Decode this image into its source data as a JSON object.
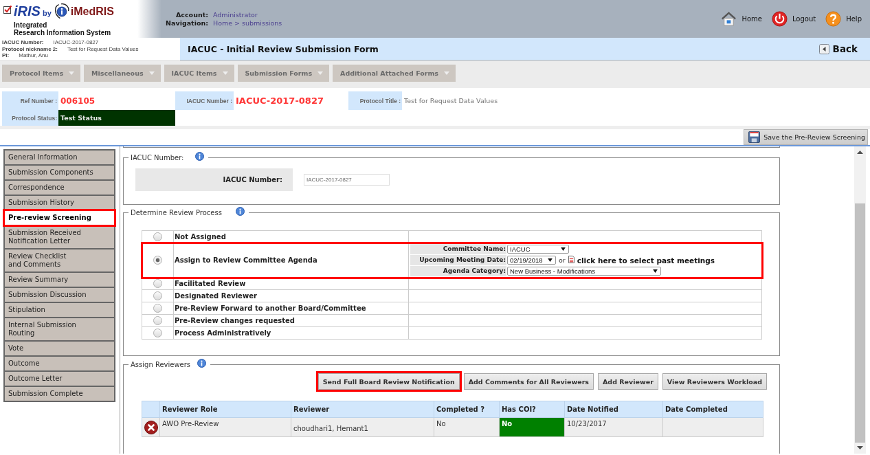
{
  "header": {
    "logo": {
      "brand": "iRIS",
      "by": "by",
      "company": "iMedRIS",
      "tagline": [
        "Integrated",
        "Research Information System"
      ]
    },
    "account": {
      "label": "Account:",
      "value": "Administrator"
    },
    "navigation": {
      "label": "Navigation:",
      "value": "Home > submissions"
    },
    "links": [
      {
        "kind": "home",
        "label": "Home"
      },
      {
        "kind": "logout",
        "label": "Logout"
      },
      {
        "kind": "help",
        "label": "Help"
      }
    ]
  },
  "protocol_summary": [
    {
      "label": "IACUC Number:",
      "value": "IACUC-2017-0827"
    },
    {
      "label": "Protocol nickname 2:",
      "value": "Test for Request Data Values"
    },
    {
      "label": "PI:",
      "value": "Mathur, Anu"
    }
  ],
  "page_title": "IACUC - Initial Review Submission Form",
  "back_button": "Back",
  "menu": [
    {
      "label": "Protocol Items"
    },
    {
      "label": "Miscellaneous"
    },
    {
      "label": "IACUC Items"
    },
    {
      "label": "Submission Forms"
    },
    {
      "label": "Additional Attached Forms"
    }
  ],
  "protocol_info": {
    "ref_number": {
      "label": "Ref Number :",
      "value": "006105"
    },
    "iacuc_number": {
      "label": "IACUC Number :",
      "value": "IACUC-2017-0827"
    },
    "protocol_title": {
      "label": "Protocol Title :",
      "value": "Test for Request Data Values"
    },
    "protocol_status": {
      "label": "Protocol Status:",
      "value": "Test Status"
    }
  },
  "save_button": "Save the Pre-Review Screening",
  "sidebar": {
    "items": [
      {
        "label": "General Information",
        "selected": false,
        "highlighted": false
      },
      {
        "label": "Submission Components",
        "selected": false,
        "highlighted": false
      },
      {
        "label": "Correspondence",
        "selected": false,
        "highlighted": false
      },
      {
        "label": "Submission History",
        "selected": false,
        "highlighted": false
      },
      {
        "label": "Pre-review Screening",
        "selected": true,
        "highlighted": true
      },
      {
        "label": "Submission Received\nNotification Letter",
        "selected": false,
        "highlighted": false
      },
      {
        "label": "Review Checklist\nand Comments",
        "selected": false,
        "highlighted": false
      },
      {
        "label": "Review Summary",
        "selected": false,
        "highlighted": false
      },
      {
        "label": "Submission Discussion",
        "selected": false,
        "highlighted": false
      },
      {
        "label": "Stipulation",
        "selected": false,
        "highlighted": false
      },
      {
        "label": "Internal Submission\nRouting",
        "selected": false,
        "highlighted": false
      },
      {
        "label": "Vote",
        "selected": false,
        "highlighted": false
      },
      {
        "label": "Outcome",
        "selected": false,
        "highlighted": false
      },
      {
        "label": "Outcome Letter",
        "selected": false,
        "highlighted": false
      },
      {
        "label": "Submission Complete",
        "selected": false,
        "highlighted": false
      }
    ]
  },
  "iacuc_number": {
    "legend": "IACUC Number:",
    "label": "IACUC Number:",
    "value": "IACUC-2017-0827"
  },
  "review_process": {
    "legend": "Determine Review Process",
    "options": [
      {
        "label": "Not Assigned",
        "selected": false,
        "highlighted": false
      },
      {
        "label": "Assign to Review Committee Agenda",
        "selected": true,
        "highlighted": true,
        "details": {
          "committee_name": {
            "label": "Committee Name:",
            "value": "IACUC"
          },
          "meeting_date": {
            "label": "Upcoming Meeting Date:",
            "value": "02/19/2018",
            "or": "or",
            "link": "click here to select past meetings"
          },
          "agenda_category": {
            "label": "Agenda Category:",
            "value": "New Business - Modifications"
          }
        }
      },
      {
        "label": "Facilitated Review",
        "selected": false,
        "highlighted": false
      },
      {
        "label": "Designated Reviewer",
        "selected": false,
        "highlighted": false
      },
      {
        "label": "Pre-Review Forward to another Board/Committee",
        "selected": false,
        "highlighted": false
      },
      {
        "label": "Pre-Review changes requested",
        "selected": false,
        "highlighted": false
      },
      {
        "label": "Process Administratively",
        "selected": false,
        "highlighted": false
      }
    ]
  },
  "assign_reviewers": {
    "legend": "Assign Reviewers",
    "buttons": [
      {
        "label": "Send Full Board Review Notification",
        "highlighted": true
      },
      {
        "label": "Add Comments for All Reviewers",
        "highlighted": false
      },
      {
        "label": "Add Reviewer",
        "highlighted": false
      },
      {
        "label": "View Reviewers Workload",
        "highlighted": false
      }
    ],
    "table": {
      "columns": [
        "Reviewer Role",
        "Reviewer",
        "Completed ?",
        "Has COI?",
        "Date Notified",
        "Date Completed"
      ],
      "rows": [
        {
          "reviewer_role": "AWO Pre-Review",
          "reviewer": "choudhari1, Hemant1",
          "completed": "No",
          "has_coi": {
            "text": "No",
            "color": "#008000"
          },
          "date_notified": "10/23/2017"
        }
      ]
    }
  }
}
